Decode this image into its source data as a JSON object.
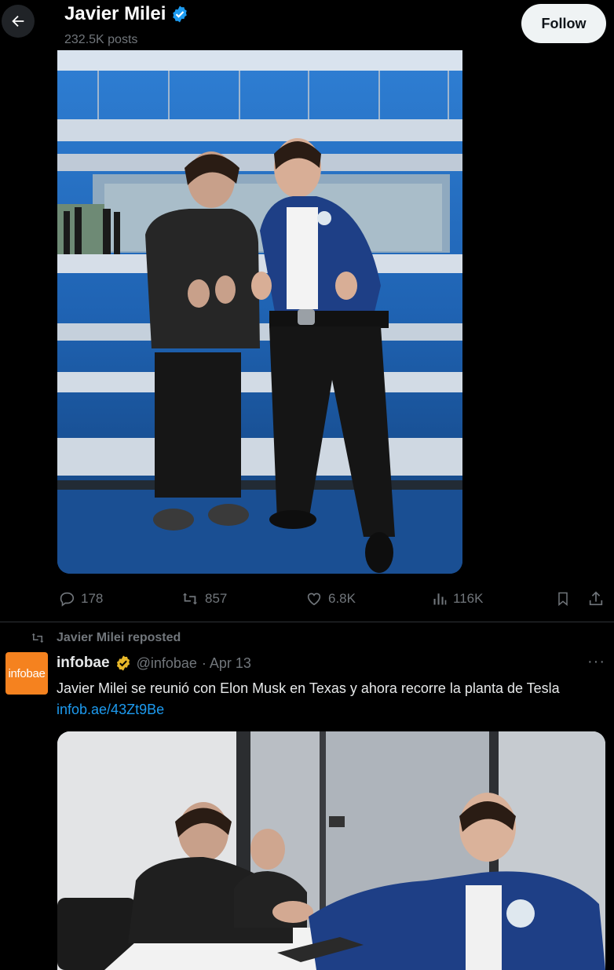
{
  "header": {
    "name": "Javier Milei",
    "posts": "232.5K posts",
    "follow_label": "Follow"
  },
  "post1": {
    "image_alt": "Javier Milei and Elon Musk giving thumbs up in front of a glass building",
    "actions": {
      "replies": "178",
      "reposts": "857",
      "likes": "6.8K",
      "views": "116K"
    }
  },
  "repost": {
    "label": "Javier Milei reposted",
    "avatar_text": "infobae",
    "name": "infobae",
    "handle": "@infobae",
    "date": "· Apr 13",
    "text": "Javier Milei se reunió con Elon Musk en Texas y ahora recorre la planta de Tesla",
    "link": "infob.ae/43Zt9Be",
    "image_alt": "Javier Milei shaking hands with Elon Musk at a conference table"
  },
  "colors": {
    "background": "#000000",
    "text": "#e7e9ea",
    "muted": "#71767b",
    "link": "#1d9bf0",
    "verified_blue": "#1d9bf0",
    "verified_gold": "#e8b829",
    "avatar_orange": "#f5821f"
  },
  "icons": [
    "back-arrow-icon",
    "verified-icon",
    "reply-icon",
    "repost-icon",
    "like-icon",
    "views-icon",
    "bookmark-icon",
    "share-icon",
    "more-icon",
    "gold-verified-icon"
  ]
}
